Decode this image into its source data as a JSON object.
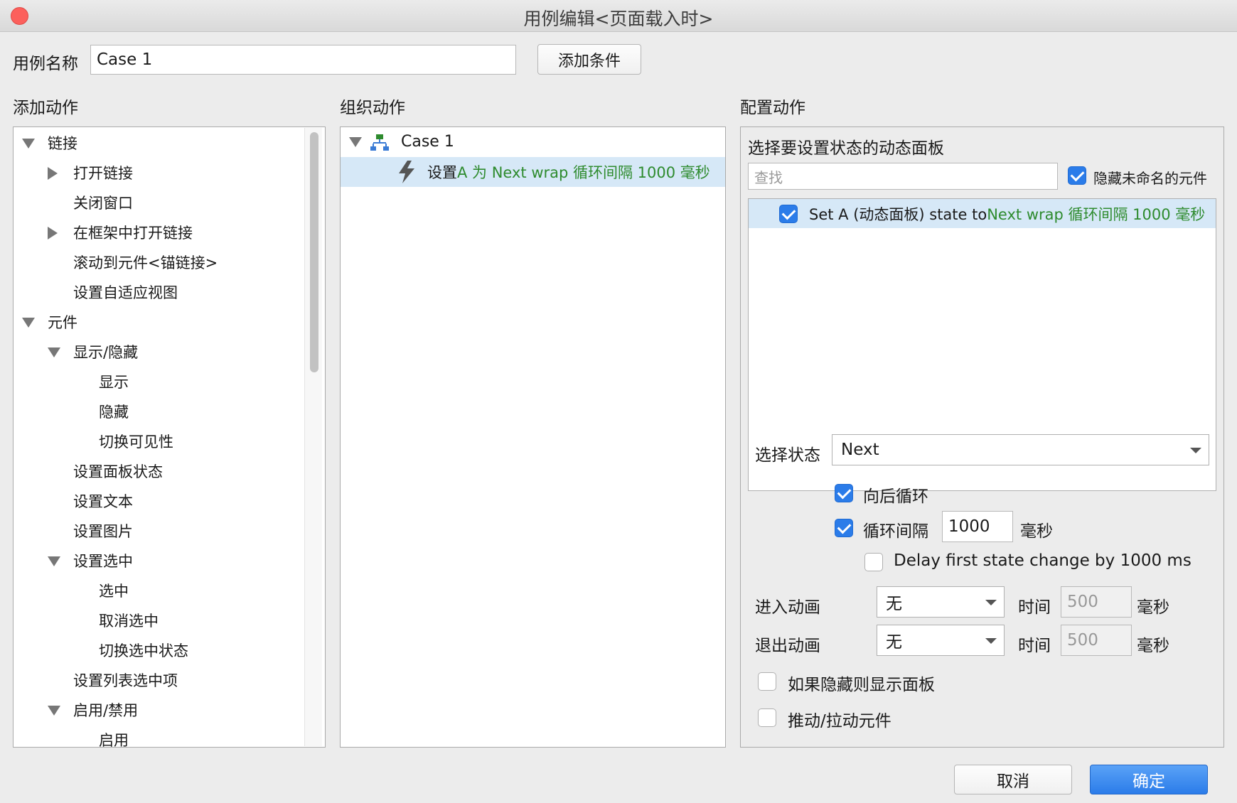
{
  "window": {
    "title": "用例编辑<页面载入时>"
  },
  "case_name": {
    "label": "用例名称",
    "value": "Case 1",
    "add_condition": "添加条件"
  },
  "sections": {
    "add_action": "添加动作",
    "organize_action": "组织动作",
    "configure_action": "配置动作"
  },
  "action_tree": [
    {
      "label": "链接",
      "expanded": true
    },
    {
      "label": "打开链接"
    },
    {
      "label": "关闭窗口"
    },
    {
      "label": "在框架中打开链接"
    },
    {
      "label": "滚动到元件<锚链接>"
    },
    {
      "label": "设置自适应视图"
    },
    {
      "label": "元件",
      "expanded": true
    },
    {
      "label": "显示/隐藏",
      "expanded": true
    },
    {
      "label": "显示"
    },
    {
      "label": "隐藏"
    },
    {
      "label": "切换可见性"
    },
    {
      "label": "设置面板状态"
    },
    {
      "label": "设置文本"
    },
    {
      "label": "设置图片"
    },
    {
      "label": "设置选中",
      "expanded": true
    },
    {
      "label": "选中"
    },
    {
      "label": "取消选中"
    },
    {
      "label": "切换选中状态"
    },
    {
      "label": "设置列表选中项"
    },
    {
      "label": "启用/禁用",
      "expanded": true
    },
    {
      "label": "启用"
    }
  ],
  "organize": {
    "case_label": "Case 1",
    "action_prefix": "设置 ",
    "action_detail": "A 为 Next wrap 循环间隔 1000 毫秒"
  },
  "configure": {
    "heading": "选择要设置状态的动态面板",
    "search_placeholder": "查找",
    "hide_unnamed": "隐藏未命名的元件",
    "panel_item_prefix": "Set A (动态面板) state to ",
    "panel_item_detail": "Next wrap 循环间隔 1000 毫秒",
    "select_state_label": "选择状态",
    "select_state_value": "Next",
    "wrap_label": "向后循环",
    "wrap_checked": true,
    "interval_label": "循环间隔",
    "interval_checked": true,
    "interval_value": "1000",
    "ms_unit": "毫秒",
    "delay_label": "Delay first state change by 1000 ms",
    "delay_checked": false,
    "enter_anim_label": "进入动画",
    "enter_anim_value": "无",
    "exit_anim_label": "退出动画",
    "exit_anim_value": "无",
    "time_label": "时间",
    "enter_time": "500",
    "exit_time": "500",
    "show_if_hidden": "如果隐藏则显示面板",
    "push_pull": "推动/拉动元件"
  },
  "footer": {
    "cancel": "取消",
    "ok": "确定"
  },
  "colors": {
    "accent": "#2b7ce9",
    "green_text": "#2e8b2e",
    "selection": "#d6e8f7"
  }
}
